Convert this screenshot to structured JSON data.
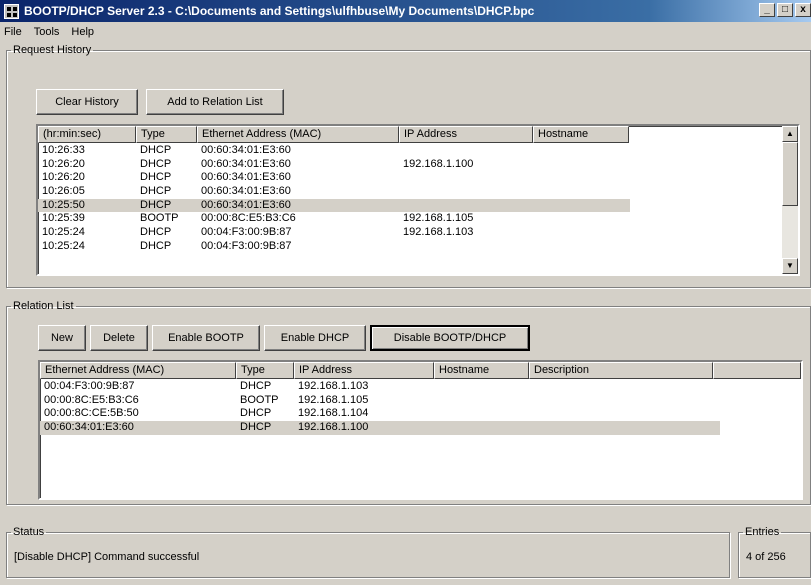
{
  "window": {
    "title": "BOOTP/DHCP Server 2.3 - C:\\Documents and Settings\\ulfhbuse\\My Documents\\DHCP.bpc",
    "minimize": "_",
    "maximize": "□",
    "close": "x"
  },
  "menu": [
    "File",
    "Tools",
    "Help"
  ],
  "request_history": {
    "legend": "Request History",
    "clear_label": "Clear History",
    "add_label": "Add to Relation List",
    "columns": [
      "(hr:min:sec)",
      "Type",
      "Ethernet Address (MAC)",
      "IP Address",
      "Hostname"
    ],
    "rows": [
      [
        "10:26:33",
        "DHCP",
        "00:60:34:01:E3:60",
        "",
        ""
      ],
      [
        "10:26:20",
        "DHCP",
        "00:60:34:01:E3:60",
        "192.168.1.100",
        ""
      ],
      [
        "10:26:20",
        "DHCP",
        "00:60:34:01:E3:60",
        "",
        ""
      ],
      [
        "10:26:05",
        "DHCP",
        "00:60:34:01:E3:60",
        "",
        ""
      ],
      [
        "10:25:50",
        "DHCP",
        "00:60:34:01:E3:60",
        "",
        ""
      ],
      [
        "10:25:39",
        "BOOTP",
        "00:00:8C:E5:B3:C6",
        "192.168.1.105",
        ""
      ],
      [
        "10:25:24",
        "DHCP",
        "00:04:F3:00:9B:87",
        "192.168.1.103",
        ""
      ],
      [
        "10:25:24",
        "DHCP",
        "00:04:F3:00:9B:87",
        "",
        ""
      ]
    ],
    "selected_row": 4
  },
  "relation_list": {
    "legend": "Relation List",
    "buttons": {
      "new": "New",
      "delete": "Delete",
      "enable_bootp": "Enable BOOTP",
      "enable_dhcp": "Enable DHCP",
      "disable": "Disable BOOTP/DHCP"
    },
    "columns": [
      "Ethernet Address (MAC)",
      "Type",
      "IP Address",
      "Hostname",
      "Description",
      ""
    ],
    "rows": [
      [
        "00:04:F3:00:9B:87",
        "DHCP",
        "192.168.1.103",
        "",
        ""
      ],
      [
        "00:00:8C:E5:B3:C6",
        "BOOTP",
        "192.168.1.105",
        "",
        ""
      ],
      [
        "00:00:8C:CE:5B:50",
        "DHCP",
        "192.168.1.104",
        "",
        ""
      ],
      [
        "00:60:34:01:E3:60",
        "DHCP",
        "192.168.1.100",
        "",
        ""
      ]
    ],
    "selected_row": 3
  },
  "status": {
    "legend": "Status",
    "message": "[Disable DHCP] Command successful"
  },
  "entries": {
    "legend": "Entries",
    "value": "4 of 256"
  }
}
